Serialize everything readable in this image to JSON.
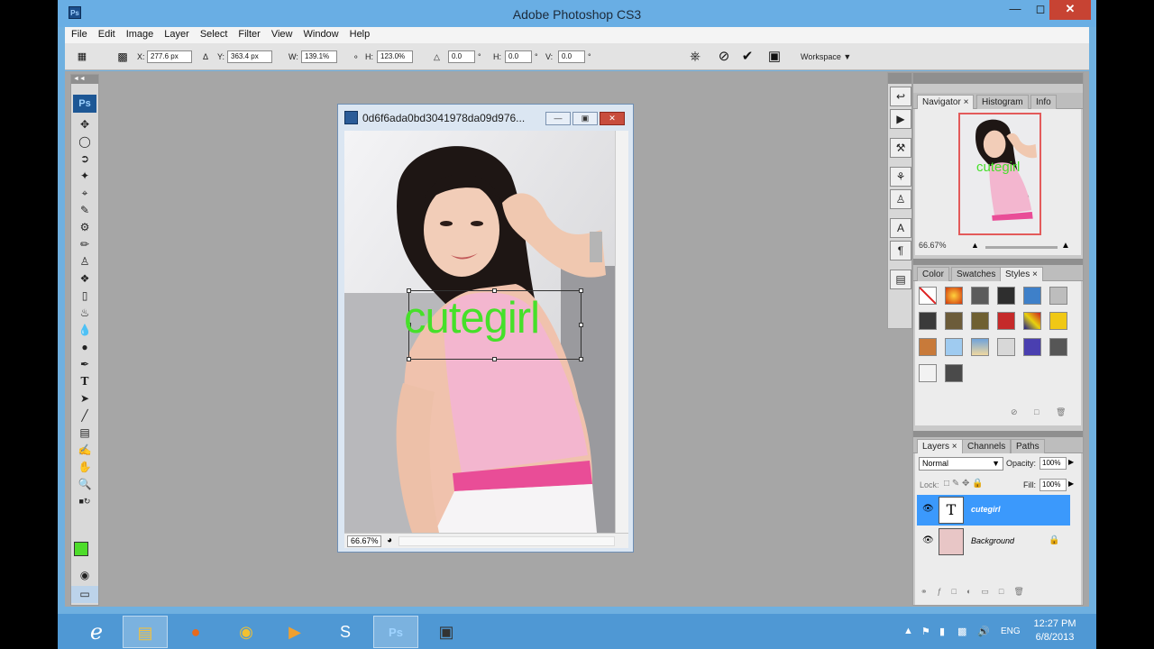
{
  "app": {
    "title": "Adobe Photoshop CS3",
    "badge": "Ps"
  },
  "menu": [
    "File",
    "Edit",
    "Image",
    "Layer",
    "Select",
    "Filter",
    "View",
    "Window",
    "Help"
  ],
  "options": {
    "x_label": "X:",
    "x_value": "277.6 px",
    "y_label": "Y:",
    "y_value": "363.4 px",
    "w_label": "W:",
    "w_value": "139.1%",
    "h_label": "H:",
    "h_value": "123.0%",
    "angle_value": "0.0",
    "angle_unit": "°",
    "hskew_label": "H:",
    "hskew_value": "0.0",
    "hskew_unit": "°",
    "vskew_label": "V:",
    "vskew_value": "0.0",
    "vskew_unit": "°",
    "workspace_label": "Workspace"
  },
  "document": {
    "title": "0d6f6ada0bd3041978da09d976...",
    "zoom": "66.67%",
    "text_layer": "cutegirl"
  },
  "navigator": {
    "tabs": [
      "Navigator",
      "Histogram",
      "Info"
    ],
    "zoom": "66.67%"
  },
  "styles_panel": {
    "tabs": [
      "Color",
      "Swatches",
      "Styles"
    ]
  },
  "layers_panel": {
    "tabs": [
      "Layers",
      "Channels",
      "Paths"
    ],
    "blend_mode": "Normal",
    "opacity_label": "Opacity:",
    "opacity_value": "100%",
    "lock_label": "Lock:",
    "fill_label": "Fill:",
    "fill_value": "100%",
    "layers": [
      {
        "name": "cutegirl",
        "thumb": "T",
        "selected": true
      },
      {
        "name": "Background",
        "thumb": "",
        "selected": false
      }
    ]
  },
  "taskbar": {
    "lang": "ENG",
    "time": "12:27 PM",
    "date": "6/8/2013"
  },
  "colors": {
    "foreground": "#4ddc2a",
    "background": "#ffffff",
    "selection": "#3b99fc",
    "text_layer": "#46e02a"
  }
}
